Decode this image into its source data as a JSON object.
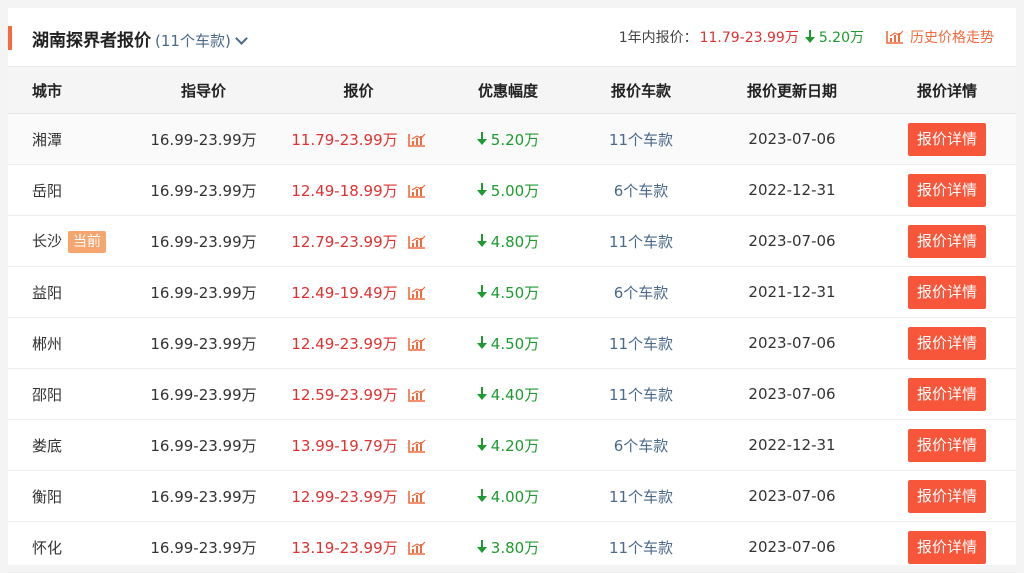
{
  "header": {
    "title": "湖南探界者报价",
    "count_label": "(11个车款)",
    "year_label": "1年内报价：",
    "year_range": "11.79-23.99万",
    "year_discount": "5.20万",
    "history_label": "历史价格走势"
  },
  "table": {
    "columns": [
      "城市",
      "指导价",
      "报价",
      "优惠幅度",
      "报价车款",
      "报价更新日期",
      "报价详情"
    ],
    "current_badge": "当前",
    "detail_label": "报价详情",
    "rows": [
      {
        "city": "湘潭",
        "guide": "16.99-23.99万",
        "price": "11.79-23.99万",
        "discount": "5.20万",
        "models": "11个车款",
        "date": "2023-07-06"
      },
      {
        "city": "岳阳",
        "guide": "16.99-23.99万",
        "price": "12.49-18.99万",
        "discount": "5.00万",
        "models": "6个车款",
        "date": "2022-12-31"
      },
      {
        "city": "长沙",
        "guide": "16.99-23.99万",
        "price": "12.79-23.99万",
        "discount": "4.80万",
        "models": "11个车款",
        "date": "2023-07-06"
      },
      {
        "city": "益阳",
        "guide": "16.99-23.99万",
        "price": "12.49-19.49万",
        "discount": "4.50万",
        "models": "6个车款",
        "date": "2021-12-31"
      },
      {
        "city": "郴州",
        "guide": "16.99-23.99万",
        "price": "12.49-23.99万",
        "discount": "4.50万",
        "models": "11个车款",
        "date": "2023-07-06"
      },
      {
        "city": "邵阳",
        "guide": "16.99-23.99万",
        "price": "12.59-23.99万",
        "discount": "4.40万",
        "models": "11个车款",
        "date": "2023-07-06"
      },
      {
        "city": "娄底",
        "guide": "16.99-23.99万",
        "price": "13.99-19.79万",
        "discount": "4.20万",
        "models": "6个车款",
        "date": "2022-12-31"
      },
      {
        "city": "衡阳",
        "guide": "16.99-23.99万",
        "price": "12.99-23.99万",
        "discount": "4.00万",
        "models": "11个车款",
        "date": "2023-07-06"
      },
      {
        "city": "怀化",
        "guide": "16.99-23.99万",
        "price": "13.19-23.99万",
        "discount": "3.80万",
        "models": "11个车款",
        "date": "2023-07-06"
      }
    ]
  },
  "icons": {
    "trend": "chart-icon",
    "discount": "arrow-down-icon",
    "expand": "chevron-down-icon"
  },
  "colors": {
    "accent": "#f36a3d",
    "price": "#e03131",
    "discount": "#1e9b2f",
    "link": "#4b6a8b",
    "button": "#f7563a"
  }
}
